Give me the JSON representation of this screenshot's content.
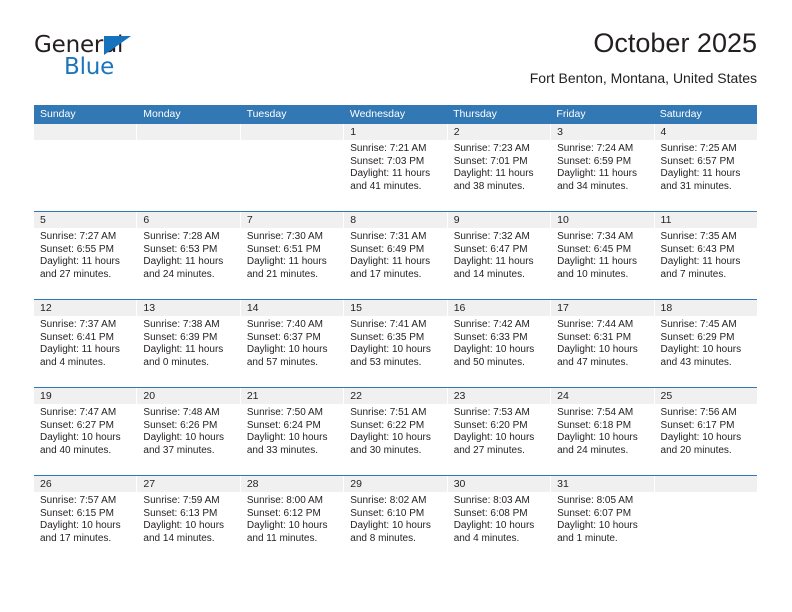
{
  "brand": {
    "line1": "General",
    "line2": "Blue",
    "triangle_icon": "blue-triangle-icon"
  },
  "header": {
    "title": "October 2025",
    "subtitle": "Fort Benton, Montana, United States"
  },
  "colors": {
    "header_blue": "#3178b5",
    "brand_blue": "#1b75bc",
    "daynum_gray": "#f0f0f0",
    "text": "#231f20"
  },
  "weekdays": [
    "Sunday",
    "Monday",
    "Tuesday",
    "Wednesday",
    "Thursday",
    "Friday",
    "Saturday"
  ],
  "weeks": [
    [
      {
        "empty": true
      },
      {
        "empty": true
      },
      {
        "empty": true
      },
      {
        "day": "1",
        "sunrise": "Sunrise: 7:21 AM",
        "sunset": "Sunset: 7:03 PM",
        "daylight1": "Daylight: 11 hours",
        "daylight2": "and 41 minutes."
      },
      {
        "day": "2",
        "sunrise": "Sunrise: 7:23 AM",
        "sunset": "Sunset: 7:01 PM",
        "daylight1": "Daylight: 11 hours",
        "daylight2": "and 38 minutes."
      },
      {
        "day": "3",
        "sunrise": "Sunrise: 7:24 AM",
        "sunset": "Sunset: 6:59 PM",
        "daylight1": "Daylight: 11 hours",
        "daylight2": "and 34 minutes."
      },
      {
        "day": "4",
        "sunrise": "Sunrise: 7:25 AM",
        "sunset": "Sunset: 6:57 PM",
        "daylight1": "Daylight: 11 hours",
        "daylight2": "and 31 minutes."
      }
    ],
    [
      {
        "day": "5",
        "sunrise": "Sunrise: 7:27 AM",
        "sunset": "Sunset: 6:55 PM",
        "daylight1": "Daylight: 11 hours",
        "daylight2": "and 27 minutes."
      },
      {
        "day": "6",
        "sunrise": "Sunrise: 7:28 AM",
        "sunset": "Sunset: 6:53 PM",
        "daylight1": "Daylight: 11 hours",
        "daylight2": "and 24 minutes."
      },
      {
        "day": "7",
        "sunrise": "Sunrise: 7:30 AM",
        "sunset": "Sunset: 6:51 PM",
        "daylight1": "Daylight: 11 hours",
        "daylight2": "and 21 minutes."
      },
      {
        "day": "8",
        "sunrise": "Sunrise: 7:31 AM",
        "sunset": "Sunset: 6:49 PM",
        "daylight1": "Daylight: 11 hours",
        "daylight2": "and 17 minutes."
      },
      {
        "day": "9",
        "sunrise": "Sunrise: 7:32 AM",
        "sunset": "Sunset: 6:47 PM",
        "daylight1": "Daylight: 11 hours",
        "daylight2": "and 14 minutes."
      },
      {
        "day": "10",
        "sunrise": "Sunrise: 7:34 AM",
        "sunset": "Sunset: 6:45 PM",
        "daylight1": "Daylight: 11 hours",
        "daylight2": "and 10 minutes."
      },
      {
        "day": "11",
        "sunrise": "Sunrise: 7:35 AM",
        "sunset": "Sunset: 6:43 PM",
        "daylight1": "Daylight: 11 hours",
        "daylight2": "and 7 minutes."
      }
    ],
    [
      {
        "day": "12",
        "sunrise": "Sunrise: 7:37 AM",
        "sunset": "Sunset: 6:41 PM",
        "daylight1": "Daylight: 11 hours",
        "daylight2": "and 4 minutes."
      },
      {
        "day": "13",
        "sunrise": "Sunrise: 7:38 AM",
        "sunset": "Sunset: 6:39 PM",
        "daylight1": "Daylight: 11 hours",
        "daylight2": "and 0 minutes."
      },
      {
        "day": "14",
        "sunrise": "Sunrise: 7:40 AM",
        "sunset": "Sunset: 6:37 PM",
        "daylight1": "Daylight: 10 hours",
        "daylight2": "and 57 minutes."
      },
      {
        "day": "15",
        "sunrise": "Sunrise: 7:41 AM",
        "sunset": "Sunset: 6:35 PM",
        "daylight1": "Daylight: 10 hours",
        "daylight2": "and 53 minutes."
      },
      {
        "day": "16",
        "sunrise": "Sunrise: 7:42 AM",
        "sunset": "Sunset: 6:33 PM",
        "daylight1": "Daylight: 10 hours",
        "daylight2": "and 50 minutes."
      },
      {
        "day": "17",
        "sunrise": "Sunrise: 7:44 AM",
        "sunset": "Sunset: 6:31 PM",
        "daylight1": "Daylight: 10 hours",
        "daylight2": "and 47 minutes."
      },
      {
        "day": "18",
        "sunrise": "Sunrise: 7:45 AM",
        "sunset": "Sunset: 6:29 PM",
        "daylight1": "Daylight: 10 hours",
        "daylight2": "and 43 minutes."
      }
    ],
    [
      {
        "day": "19",
        "sunrise": "Sunrise: 7:47 AM",
        "sunset": "Sunset: 6:27 PM",
        "daylight1": "Daylight: 10 hours",
        "daylight2": "and 40 minutes."
      },
      {
        "day": "20",
        "sunrise": "Sunrise: 7:48 AM",
        "sunset": "Sunset: 6:26 PM",
        "daylight1": "Daylight: 10 hours",
        "daylight2": "and 37 minutes."
      },
      {
        "day": "21",
        "sunrise": "Sunrise: 7:50 AM",
        "sunset": "Sunset: 6:24 PM",
        "daylight1": "Daylight: 10 hours",
        "daylight2": "and 33 minutes."
      },
      {
        "day": "22",
        "sunrise": "Sunrise: 7:51 AM",
        "sunset": "Sunset: 6:22 PM",
        "daylight1": "Daylight: 10 hours",
        "daylight2": "and 30 minutes."
      },
      {
        "day": "23",
        "sunrise": "Sunrise: 7:53 AM",
        "sunset": "Sunset: 6:20 PM",
        "daylight1": "Daylight: 10 hours",
        "daylight2": "and 27 minutes."
      },
      {
        "day": "24",
        "sunrise": "Sunrise: 7:54 AM",
        "sunset": "Sunset: 6:18 PM",
        "daylight1": "Daylight: 10 hours",
        "daylight2": "and 24 minutes."
      },
      {
        "day": "25",
        "sunrise": "Sunrise: 7:56 AM",
        "sunset": "Sunset: 6:17 PM",
        "daylight1": "Daylight: 10 hours",
        "daylight2": "and 20 minutes."
      }
    ],
    [
      {
        "day": "26",
        "sunrise": "Sunrise: 7:57 AM",
        "sunset": "Sunset: 6:15 PM",
        "daylight1": "Daylight: 10 hours",
        "daylight2": "and 17 minutes."
      },
      {
        "day": "27",
        "sunrise": "Sunrise: 7:59 AM",
        "sunset": "Sunset: 6:13 PM",
        "daylight1": "Daylight: 10 hours",
        "daylight2": "and 14 minutes."
      },
      {
        "day": "28",
        "sunrise": "Sunrise: 8:00 AM",
        "sunset": "Sunset: 6:12 PM",
        "daylight1": "Daylight: 10 hours",
        "daylight2": "and 11 minutes."
      },
      {
        "day": "29",
        "sunrise": "Sunrise: 8:02 AM",
        "sunset": "Sunset: 6:10 PM",
        "daylight1": "Daylight: 10 hours",
        "daylight2": "and 8 minutes."
      },
      {
        "day": "30",
        "sunrise": "Sunrise: 8:03 AM",
        "sunset": "Sunset: 6:08 PM",
        "daylight1": "Daylight: 10 hours",
        "daylight2": "and 4 minutes."
      },
      {
        "day": "31",
        "sunrise": "Sunrise: 8:05 AM",
        "sunset": "Sunset: 6:07 PM",
        "daylight1": "Daylight: 10 hours",
        "daylight2": "and 1 minute."
      },
      {
        "empty": true
      }
    ]
  ]
}
